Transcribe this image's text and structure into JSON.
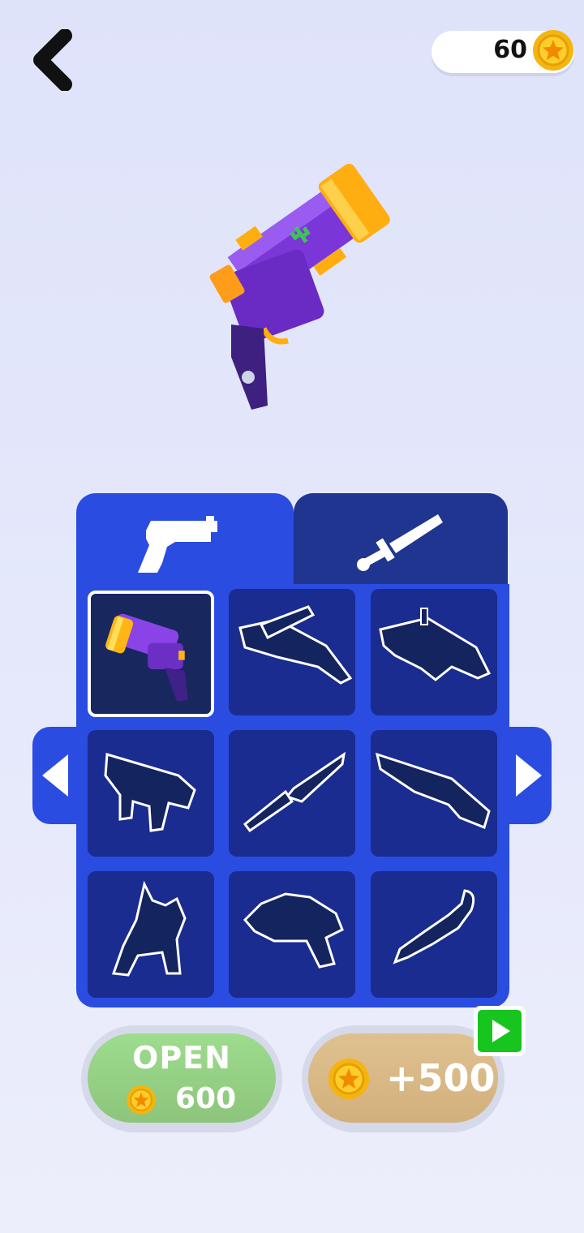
{
  "header": {
    "coins": "60",
    "back_icon": "chevron-left-icon",
    "coin_icon": "star-coin-icon"
  },
  "tabs": [
    {
      "name": "guns",
      "icon": "pistol-icon",
      "active": true
    },
    {
      "name": "melee",
      "icon": "sword-icon",
      "active": false
    }
  ],
  "grid": {
    "items": [
      {
        "icon": "purple-revolver-icon",
        "unlocked": true,
        "selected": true
      },
      {
        "icon": "crossbow-silhouette-icon",
        "unlocked": false
      },
      {
        "icon": "rocket-launcher-silhouette-icon",
        "unlocked": false
      },
      {
        "icon": "smg-silhouette-icon",
        "unlocked": false
      },
      {
        "icon": "combat-knife-silhouette-icon",
        "unlocked": false
      },
      {
        "icon": "shotgun-silhouette-icon",
        "unlocked": false
      },
      {
        "icon": "wolf-silhouette-icon",
        "unlocked": false
      },
      {
        "icon": "hedgehog-blaster-silhouette-icon",
        "unlocked": false
      },
      {
        "icon": "squirrel-silhouette-icon",
        "unlocked": false
      }
    ]
  },
  "buttons": {
    "open_label": "OPEN",
    "open_price": "600",
    "bonus_label": "+500",
    "video_icon": "play-video-icon"
  },
  "colors": {
    "panel": "#2a4ce0",
    "tab_inactive": "#1f3590",
    "slot": "#1a2c8f",
    "open_green": "#94d184",
    "bonus_gold": "#d8b886",
    "coin_gold": "#f5b50e",
    "video_green": "#17c51f"
  }
}
